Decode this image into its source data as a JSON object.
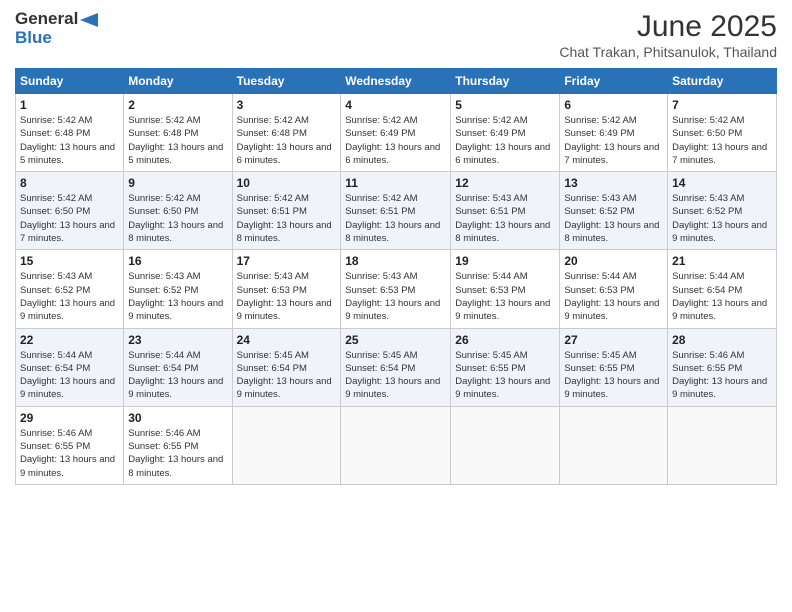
{
  "logo": {
    "line1": "General",
    "line2": "Blue"
  },
  "title": "June 2025",
  "subtitle": "Chat Trakan, Phitsanulok, Thailand",
  "headers": [
    "Sunday",
    "Monday",
    "Tuesday",
    "Wednesday",
    "Thursday",
    "Friday",
    "Saturday"
  ],
  "weeks": [
    [
      {
        "day": "1",
        "sunrise": "5:42 AM",
        "sunset": "6:48 PM",
        "daylight": "13 hours and 5 minutes."
      },
      {
        "day": "2",
        "sunrise": "5:42 AM",
        "sunset": "6:48 PM",
        "daylight": "13 hours and 5 minutes."
      },
      {
        "day": "3",
        "sunrise": "5:42 AM",
        "sunset": "6:48 PM",
        "daylight": "13 hours and 6 minutes."
      },
      {
        "day": "4",
        "sunrise": "5:42 AM",
        "sunset": "6:49 PM",
        "daylight": "13 hours and 6 minutes."
      },
      {
        "day": "5",
        "sunrise": "5:42 AM",
        "sunset": "6:49 PM",
        "daylight": "13 hours and 6 minutes."
      },
      {
        "day": "6",
        "sunrise": "5:42 AM",
        "sunset": "6:49 PM",
        "daylight": "13 hours and 7 minutes."
      },
      {
        "day": "7",
        "sunrise": "5:42 AM",
        "sunset": "6:50 PM",
        "daylight": "13 hours and 7 minutes."
      }
    ],
    [
      {
        "day": "8",
        "sunrise": "5:42 AM",
        "sunset": "6:50 PM",
        "daylight": "13 hours and 7 minutes."
      },
      {
        "day": "9",
        "sunrise": "5:42 AM",
        "sunset": "6:50 PM",
        "daylight": "13 hours and 8 minutes."
      },
      {
        "day": "10",
        "sunrise": "5:42 AM",
        "sunset": "6:51 PM",
        "daylight": "13 hours and 8 minutes."
      },
      {
        "day": "11",
        "sunrise": "5:42 AM",
        "sunset": "6:51 PM",
        "daylight": "13 hours and 8 minutes."
      },
      {
        "day": "12",
        "sunrise": "5:43 AM",
        "sunset": "6:51 PM",
        "daylight": "13 hours and 8 minutes."
      },
      {
        "day": "13",
        "sunrise": "5:43 AM",
        "sunset": "6:52 PM",
        "daylight": "13 hours and 8 minutes."
      },
      {
        "day": "14",
        "sunrise": "5:43 AM",
        "sunset": "6:52 PM",
        "daylight": "13 hours and 9 minutes."
      }
    ],
    [
      {
        "day": "15",
        "sunrise": "5:43 AM",
        "sunset": "6:52 PM",
        "daylight": "13 hours and 9 minutes."
      },
      {
        "day": "16",
        "sunrise": "5:43 AM",
        "sunset": "6:52 PM",
        "daylight": "13 hours and 9 minutes."
      },
      {
        "day": "17",
        "sunrise": "5:43 AM",
        "sunset": "6:53 PM",
        "daylight": "13 hours and 9 minutes."
      },
      {
        "day": "18",
        "sunrise": "5:43 AM",
        "sunset": "6:53 PM",
        "daylight": "13 hours and 9 minutes."
      },
      {
        "day": "19",
        "sunrise": "5:44 AM",
        "sunset": "6:53 PM",
        "daylight": "13 hours and 9 minutes."
      },
      {
        "day": "20",
        "sunrise": "5:44 AM",
        "sunset": "6:53 PM",
        "daylight": "13 hours and 9 minutes."
      },
      {
        "day": "21",
        "sunrise": "5:44 AM",
        "sunset": "6:54 PM",
        "daylight": "13 hours and 9 minutes."
      }
    ],
    [
      {
        "day": "22",
        "sunrise": "5:44 AM",
        "sunset": "6:54 PM",
        "daylight": "13 hours and 9 minutes."
      },
      {
        "day": "23",
        "sunrise": "5:44 AM",
        "sunset": "6:54 PM",
        "daylight": "13 hours and 9 minutes."
      },
      {
        "day": "24",
        "sunrise": "5:45 AM",
        "sunset": "6:54 PM",
        "daylight": "13 hours and 9 minutes."
      },
      {
        "day": "25",
        "sunrise": "5:45 AM",
        "sunset": "6:54 PM",
        "daylight": "13 hours and 9 minutes."
      },
      {
        "day": "26",
        "sunrise": "5:45 AM",
        "sunset": "6:55 PM",
        "daylight": "13 hours and 9 minutes."
      },
      {
        "day": "27",
        "sunrise": "5:45 AM",
        "sunset": "6:55 PM",
        "daylight": "13 hours and 9 minutes."
      },
      {
        "day": "28",
        "sunrise": "5:46 AM",
        "sunset": "6:55 PM",
        "daylight": "13 hours and 9 minutes."
      }
    ],
    [
      {
        "day": "29",
        "sunrise": "5:46 AM",
        "sunset": "6:55 PM",
        "daylight": "13 hours and 9 minutes."
      },
      {
        "day": "30",
        "sunrise": "5:46 AM",
        "sunset": "6:55 PM",
        "daylight": "13 hours and 8 minutes."
      },
      null,
      null,
      null,
      null,
      null
    ]
  ]
}
